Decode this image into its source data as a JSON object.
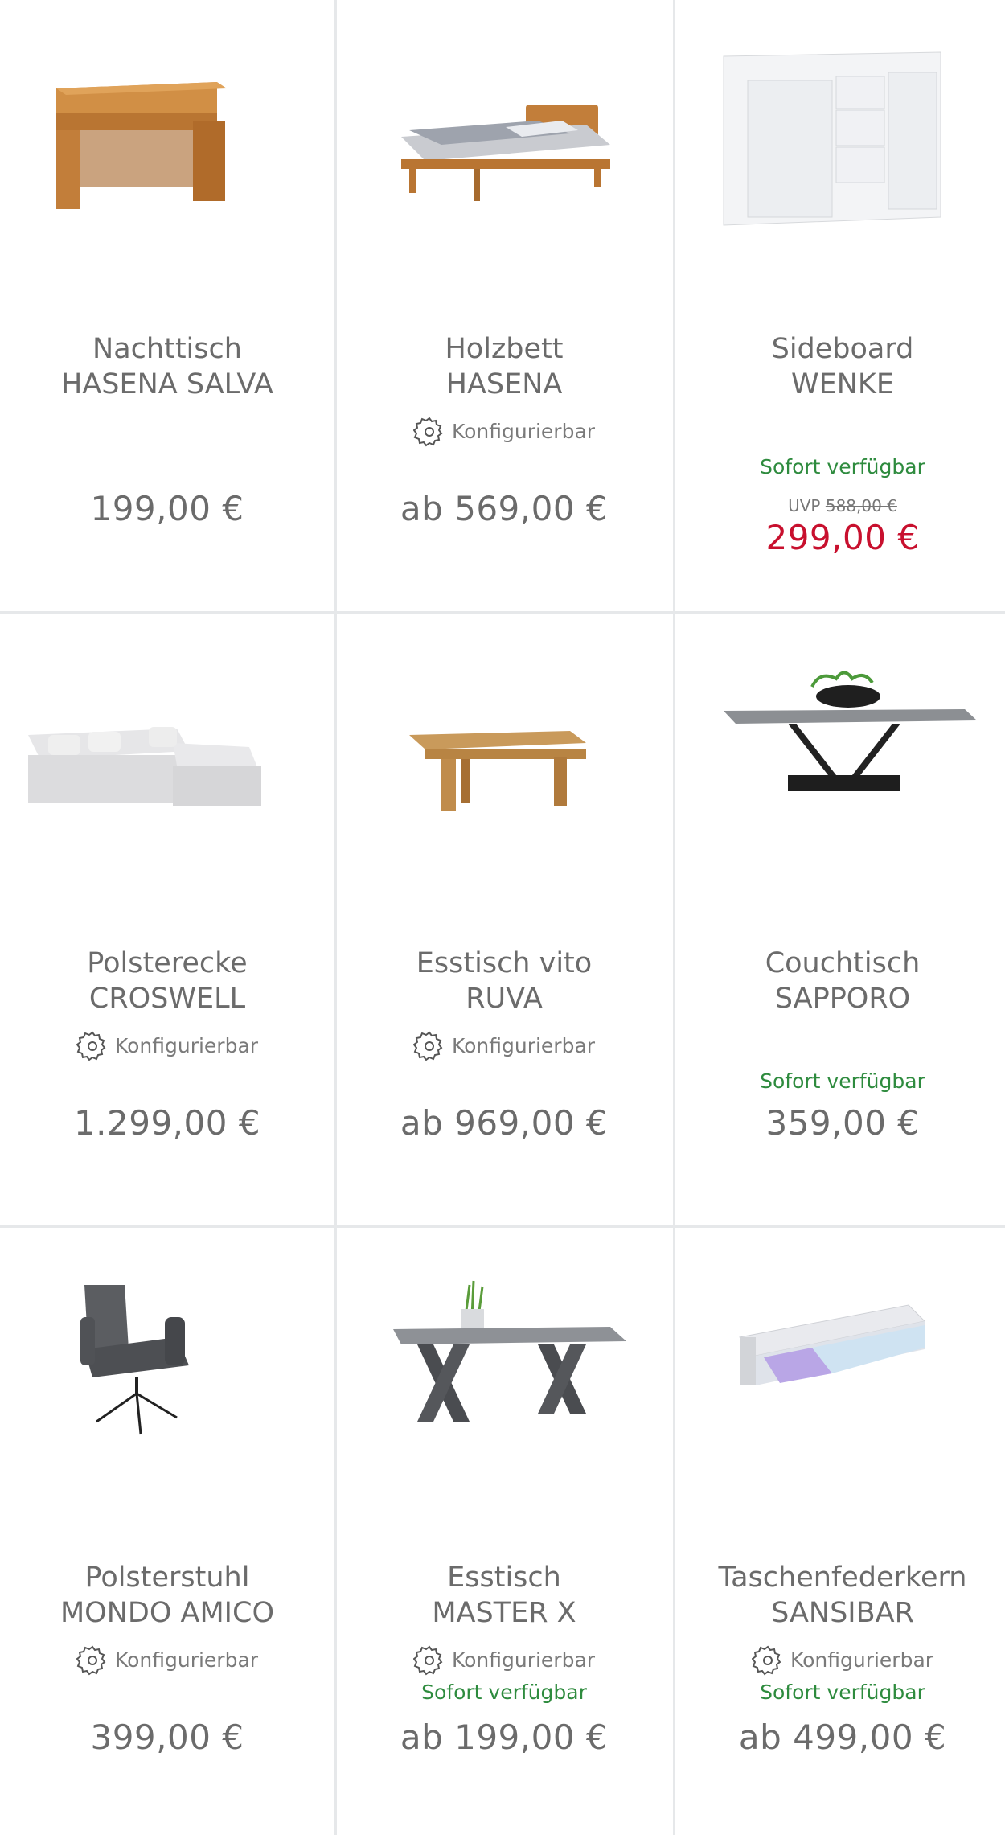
{
  "colors": {
    "text": "#6b6b6b",
    "available_green": "#2e8b3e",
    "sale_red": "#c8102e",
    "divider": "#e6e8ea"
  },
  "products": [
    {
      "name_line1": "Nachttisch",
      "name_line2": "HASENA SALVA",
      "configurable": "",
      "availability": "",
      "uvp_label": "",
      "uvp_price": "",
      "price": "199,00 €",
      "image_icon": "nightstand-image"
    },
    {
      "name_line1": "Holzbett",
      "name_line2": "HASENA",
      "configurable": "Konfigurierbar",
      "availability": "",
      "uvp_label": "",
      "uvp_price": "",
      "price": "ab 569,00 €",
      "image_icon": "bed-image"
    },
    {
      "name_line1": "Sideboard",
      "name_line2": "WENKE",
      "configurable": "",
      "availability": "Sofort verfügbar",
      "uvp_label": "UVP",
      "uvp_price": "588,00 €",
      "price": "299,00 €",
      "image_icon": "sideboard-image"
    },
    {
      "name_line1": "Polsterecke",
      "name_line2": "CROSWELL",
      "configurable": "Konfigurierbar",
      "availability": "",
      "uvp_label": "",
      "uvp_price": "",
      "price": "1.299,00 €",
      "image_icon": "sofa-image"
    },
    {
      "name_line1": "Esstisch vito",
      "name_line2": "RUVA",
      "configurable": "Konfigurierbar",
      "availability": "",
      "uvp_label": "",
      "uvp_price": "",
      "price": "ab 969,00 €",
      "image_icon": "dining-table-image"
    },
    {
      "name_line1": "Couchtisch",
      "name_line2": "SAPPORO",
      "configurable": "",
      "availability": "Sofort verfügbar",
      "uvp_label": "",
      "uvp_price": "",
      "price": "359,00 €",
      "image_icon": "coffee-table-image"
    },
    {
      "name_line1": "Polsterstuhl",
      "name_line2": "MONDO AMICO",
      "configurable": "Konfigurierbar",
      "availability": "",
      "uvp_label": "",
      "uvp_price": "",
      "price": "399,00 €",
      "image_icon": "chair-image"
    },
    {
      "name_line1": "Esstisch",
      "name_line2": "MASTER X",
      "configurable": "Konfigurierbar",
      "availability": "Sofort verfügbar",
      "uvp_label": "",
      "uvp_price": "",
      "price": "ab 199,00 €",
      "image_icon": "x-table-image"
    },
    {
      "name_line1": "Taschenfederkern",
      "name_line2": "SANSIBAR",
      "configurable": "Konfigurierbar",
      "availability": "Sofort verfügbar",
      "uvp_label": "",
      "uvp_price": "",
      "price": "ab 499,00 €",
      "image_icon": "mattress-image"
    }
  ]
}
